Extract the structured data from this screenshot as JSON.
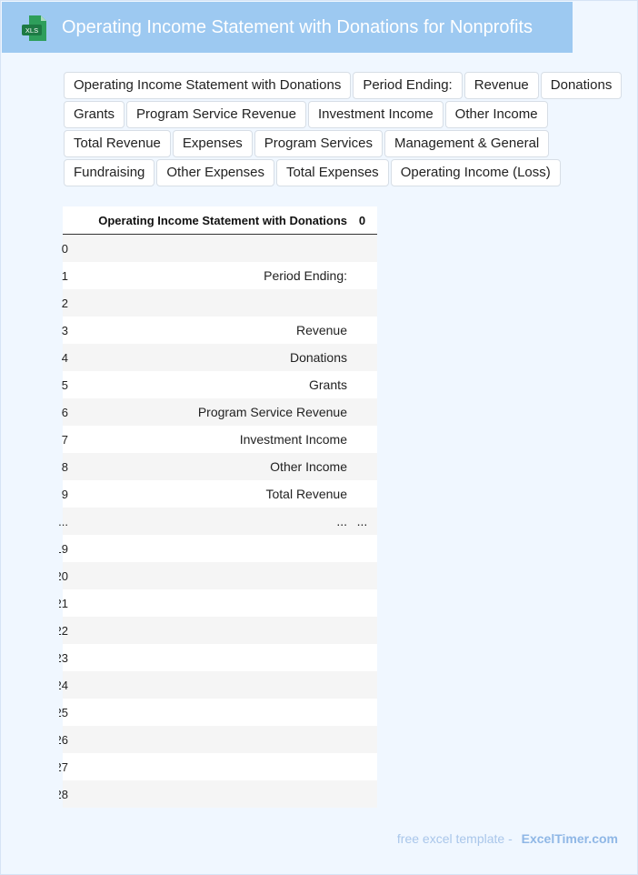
{
  "header": {
    "icon": "xls-file-icon",
    "icon_text": "XLS",
    "title": "Operating Income Statement with Donations for Nonprofits"
  },
  "tags": [
    "Operating Income Statement with Donations",
    "Period Ending:",
    "Revenue",
    "Donations",
    "Grants",
    "Program Service Revenue",
    "Investment Income",
    "Other Income",
    "Total Revenue",
    "Expenses",
    "Program Services",
    "Management & General",
    "Fundraising",
    "Other Expenses",
    "Total Expenses",
    "Operating Income (Loss)"
  ],
  "table": {
    "columns": [
      "Operating Income Statement with Donations",
      "0"
    ],
    "rows": [
      {
        "index": "0",
        "label": "",
        "value": ""
      },
      {
        "index": "1",
        "label": "Period Ending:",
        "value": ""
      },
      {
        "index": "2",
        "label": "",
        "value": ""
      },
      {
        "index": "3",
        "label": "Revenue",
        "value": ""
      },
      {
        "index": "4",
        "label": "Donations",
        "value": ""
      },
      {
        "index": "5",
        "label": "Grants",
        "value": ""
      },
      {
        "index": "6",
        "label": "Program Service Revenue",
        "value": ""
      },
      {
        "index": "7",
        "label": "Investment Income",
        "value": ""
      },
      {
        "index": "8",
        "label": "Other Income",
        "value": ""
      },
      {
        "index": "9",
        "label": "Total Revenue",
        "value": ""
      },
      {
        "index": "...",
        "label": "...",
        "value": "..."
      },
      {
        "index": "19",
        "label": "",
        "value": ""
      },
      {
        "index": "20",
        "label": "",
        "value": ""
      },
      {
        "index": "21",
        "label": "",
        "value": ""
      },
      {
        "index": "22",
        "label": "",
        "value": ""
      },
      {
        "index": "23",
        "label": "",
        "value": ""
      },
      {
        "index": "24",
        "label": "",
        "value": ""
      },
      {
        "index": "25",
        "label": "",
        "value": ""
      },
      {
        "index": "26",
        "label": "",
        "value": ""
      },
      {
        "index": "27",
        "label": "",
        "value": ""
      },
      {
        "index": "28",
        "label": "",
        "value": ""
      }
    ]
  },
  "footer": {
    "text": "free excel template -",
    "brand": "ExcelTimer.com"
  },
  "colors": {
    "header_bg": "#9dc9f1",
    "page_bg": "#f0f7ff",
    "icon_green": "#1d7a44"
  }
}
